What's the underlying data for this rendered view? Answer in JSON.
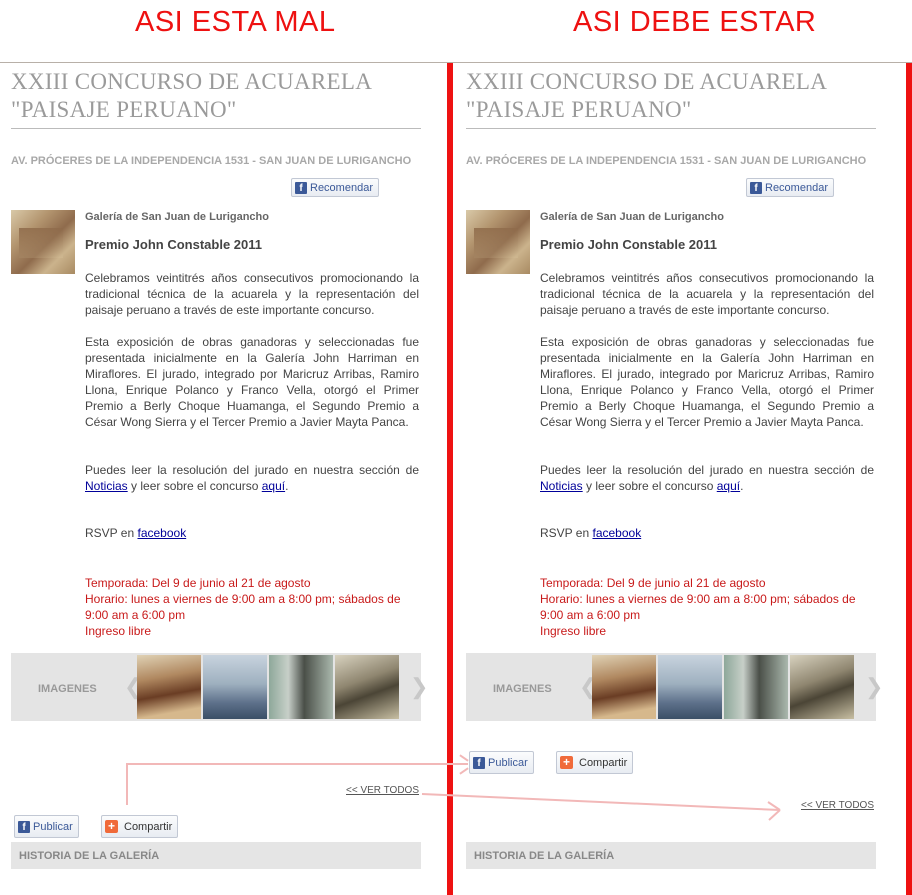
{
  "headings": {
    "wrong": "ASI ESTA MAL",
    "right": "ASI DEBE ESTAR"
  },
  "colors": {
    "heading_red": "#ee1111",
    "divider_red": "#ee1111",
    "season_red": "#c81a1a",
    "facebook_blue": "#3b5998",
    "share_orange": "#f06a3a"
  },
  "event": {
    "title_line1": "XXIII CONCURSO DE ACUARELA",
    "title_line2": "\"PAISAJE PERUANO\"",
    "address": "AV. PRÓCERES DE LA INDEPENDENCIA 1531 - SAN JUAN DE LURIGANCHO",
    "recommend_label": "Recomendar",
    "gallery": "Galería de San Juan de Lurigancho",
    "prize": "Premio John Constable 2011",
    "paragraph1": "Celebramos veintitrés años consecutivos promocionando la tradicional técnica de la acuarela y la representación del paisaje peruano a través de este importante concurso.",
    "paragraph2": "Esta exposición de obras ganadoras y seleccionadas fue presentada inicialmente en la Galería John Harriman en Miraflores. El jurado, integrado por Maricruz Arribas, Ramiro Llona, Enrique Polanco y Franco Vella, otorgó el Primer Premio a Berly Choque Huamanga, el Segundo Premio a César Wong Sierra y el Tercer Premio a Javier Mayta Panca.",
    "paragraph3_pre": "Puedes leer la resolución del  jurado en nuestra sección de ",
    "paragraph3_link1": "Noticias",
    "paragraph3_mid": " y leer sobre el concurso ",
    "paragraph3_link2": "aquí",
    "paragraph3_end": ".",
    "rsvp_pre": "RSVP en ",
    "rsvp_link": "facebook",
    "season": "Temporada: Del 9 de junio al 21 de agosto",
    "schedule": "Horario: lunes a viernes de 9:00 am a 8:00 pm; sábados de 9:00 am a 6:00 pm",
    "admission": "Ingreso libre",
    "images_label": "IMAGENES",
    "arrow_left": "❮",
    "arrow_right": "❯",
    "fb_glyph": "f",
    "plus_glyph": "+",
    "publish_label": "Publicar",
    "share_label": "Compartir",
    "view_all": "<< VER TODOS",
    "history_label": "HISTORIA DE LA GALERÍA"
  }
}
